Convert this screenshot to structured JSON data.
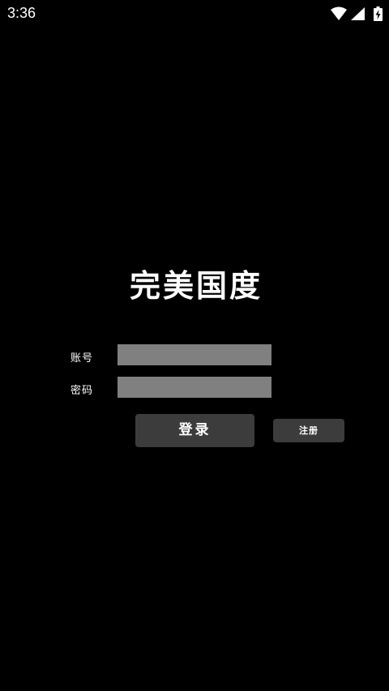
{
  "status_bar": {
    "time": "3:36",
    "icons": [
      "wifi-icon",
      "signal-icon",
      "battery-charging-icon"
    ]
  },
  "app": {
    "title": "完美国度"
  },
  "form": {
    "account_label": "账号",
    "account_value": "",
    "password_label": "密码",
    "password_value": ""
  },
  "buttons": {
    "login_label": "登录",
    "register_label": "注册"
  },
  "colors": {
    "background": "#000000",
    "field_fill": "#808080",
    "button_fill": "#3c3c3c",
    "text": "#ffffff"
  }
}
